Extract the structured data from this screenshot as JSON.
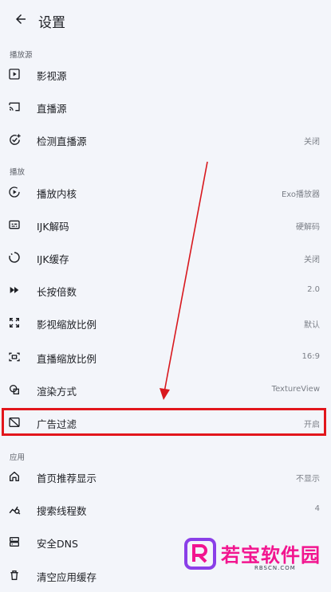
{
  "appbar": {
    "title": "设置",
    "back_icon": "arrow-left-icon"
  },
  "sections": {
    "playback_source": "播放源",
    "playback": "播放",
    "app": "应用"
  },
  "items": [
    {
      "label": "影视源",
      "value": "",
      "icon": "play-square-icon"
    },
    {
      "label": "直播源",
      "value": "",
      "icon": "cast-icon"
    },
    {
      "label": "检测直播源",
      "value": "关闭",
      "icon": "check-circle-plus-icon"
    },
    {
      "label": "播放内核",
      "value": "Exo播放器",
      "icon": "play-circle-icon"
    },
    {
      "label": "IJK解码",
      "value": "硬解码",
      "icon": "subtitles-icon"
    },
    {
      "label": "IJK缓存",
      "value": "关闭",
      "icon": "loading-circle-icon"
    },
    {
      "label": "长按倍数",
      "value": "2.0",
      "icon": "fast-forward-icon"
    },
    {
      "label": "影视缩放比例",
      "value": "默认",
      "icon": "expand-icon"
    },
    {
      "label": "直播缩放比例",
      "value": "16:9",
      "icon": "aspect-ratio-icon"
    },
    {
      "label": "渲染方式",
      "value": "TextureView",
      "icon": "shapes-icon"
    },
    {
      "label": "广告过滤",
      "value": "开启",
      "icon": "ad-block-icon"
    },
    {
      "label": "首页推荐显示",
      "value": "不显示",
      "icon": "home-icon"
    },
    {
      "label": "搜索线程数",
      "value": "4",
      "icon": "search-threads-icon"
    },
    {
      "label": "安全DNS",
      "value": "",
      "icon": "dns-icon"
    },
    {
      "label": "清空应用缓存",
      "value": "",
      "icon": "trash-icon"
    }
  ],
  "annotation": {
    "color": "#e2161c"
  },
  "watermark": {
    "name": "若宝软件园",
    "site": "RBSCN.COM",
    "color": "#f2158f"
  }
}
